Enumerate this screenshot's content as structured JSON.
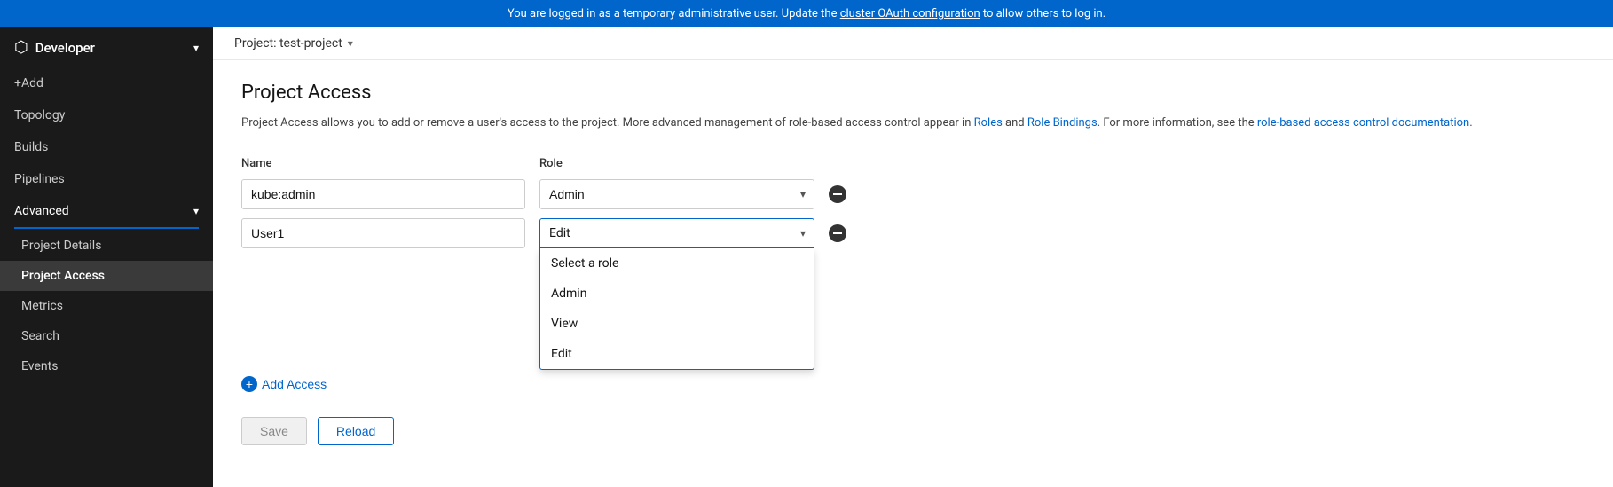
{
  "banner": {
    "text_before": "You are logged in as a temporary administrative user. Update the ",
    "link1_text": "cluster OAuth configuration",
    "text_middle": " to allow others to log in.",
    "link1_href": "#"
  },
  "sidebar": {
    "app_name": "Developer",
    "add_label": "+Add",
    "items": [
      {
        "id": "topology",
        "label": "Topology"
      },
      {
        "id": "builds",
        "label": "Builds"
      },
      {
        "id": "pipelines",
        "label": "Pipelines"
      }
    ],
    "advanced_section": {
      "label": "Advanced",
      "sub_items": [
        {
          "id": "project-details",
          "label": "Project Details"
        },
        {
          "id": "project-access",
          "label": "Project Access",
          "active": true
        },
        {
          "id": "metrics",
          "label": "Metrics"
        },
        {
          "id": "search",
          "label": "Search"
        },
        {
          "id": "events",
          "label": "Events"
        }
      ]
    }
  },
  "project_bar": {
    "label": "Project: test-project"
  },
  "page": {
    "title": "Project Access",
    "description_parts": {
      "before": "Project Access allows you to add or remove a user's access to the project. More advanced management of role-based access control appear in ",
      "roles_link": "Roles",
      "middle": " and ",
      "role_bindings_link": "Role Bindings",
      "after": ". For more information, see the ",
      "rbac_link": "role-based access control documentation",
      "end": "."
    },
    "table_headers": {
      "name": "Name",
      "role": "Role"
    },
    "rows": [
      {
        "name": "kube:admin",
        "role": "Admin"
      },
      {
        "name": "User1",
        "role": "Edit"
      }
    ],
    "dropdown_options": [
      {
        "value": "select",
        "label": "Select a role"
      },
      {
        "value": "admin",
        "label": "Admin"
      },
      {
        "value": "view",
        "label": "View"
      },
      {
        "value": "edit",
        "label": "Edit"
      }
    ],
    "add_access_label": "Add Access",
    "save_label": "Save",
    "reload_label": "Reload"
  }
}
